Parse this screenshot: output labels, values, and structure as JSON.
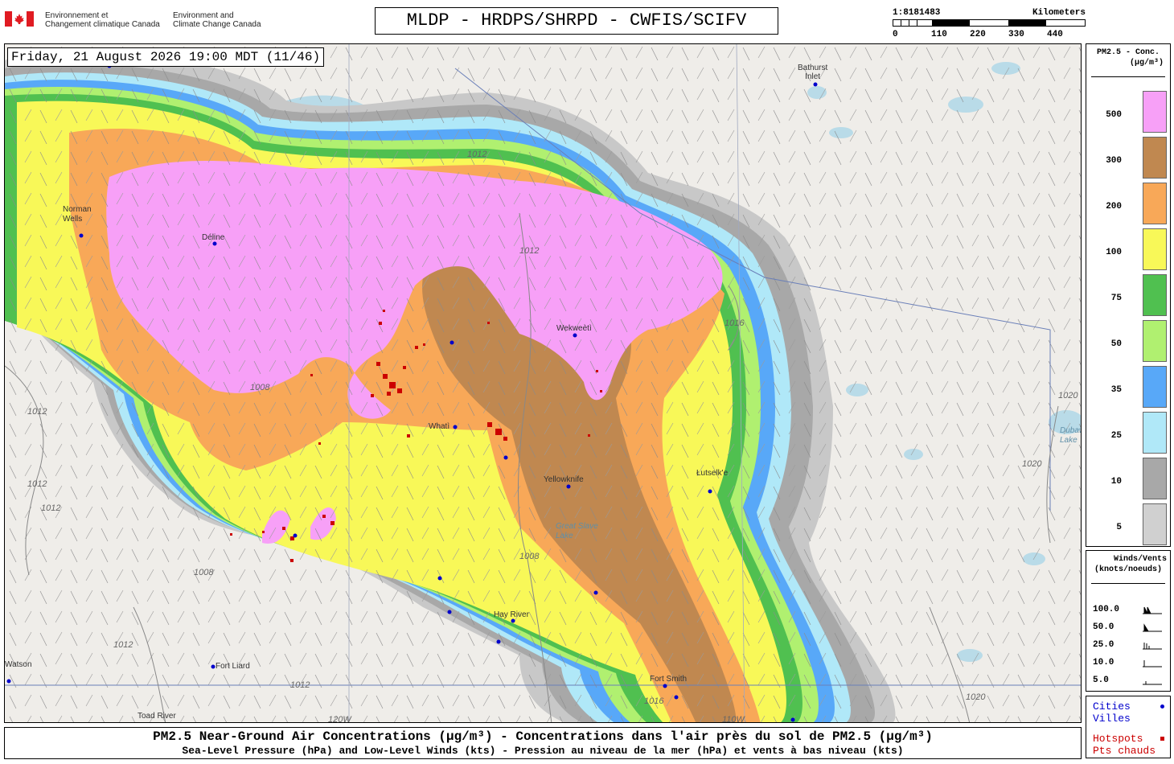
{
  "header": {
    "gov_fr_line1": "Environnement et",
    "gov_fr_line2": "Changement climatique Canada",
    "gov_en_line1": "Environment and",
    "gov_en_line2": "Climate Change Canada",
    "title": "MLDP - HRDPS/SHRPD - CWFIS/SCIFV"
  },
  "scale_bar": {
    "ratio": "1:8181483",
    "unit": "Kilometers",
    "ticks": [
      "0",
      "110",
      "220",
      "330",
      "440"
    ]
  },
  "map": {
    "datetime": "Friday, 21 August 2026 19:00 MDT (11/46)",
    "cities": [
      {
        "name": "Bathurst",
        "name2": "Inlet"
      },
      {
        "name": "Norman",
        "name2": "Wells"
      },
      {
        "name": "Déline"
      },
      {
        "name": "Wekweètì"
      },
      {
        "name": "Whatì"
      },
      {
        "name": "Yellowknife"
      },
      {
        "name": "Łutselk'e"
      },
      {
        "name": "Hay River"
      },
      {
        "name": "Fort Liard"
      },
      {
        "name": "Fort Smith"
      },
      {
        "name": "Toad River"
      },
      {
        "name": "Watson"
      },
      {
        "name": "Dubawnt",
        "name2": "Lake"
      },
      {
        "name": "Great Slave",
        "name2": "Lake"
      }
    ],
    "isobars": [
      "1012",
      "1012",
      "1012",
      "1016",
      "1008",
      "1008",
      "1008",
      "1012",
      "1020",
      "1020",
      "1012",
      "1012",
      "1020",
      "1016",
      "1012"
    ],
    "longitudes": [
      "120W",
      "110W"
    ]
  },
  "legend_pm25": {
    "title_line1": "PM2.5 - Conc.",
    "title_line2": "(µg/m³)",
    "bins": [
      {
        "label": "500",
        "color": "#f7a0f7"
      },
      {
        "label": "300",
        "color": "#c08850"
      },
      {
        "label": "200",
        "color": "#f8a858"
      },
      {
        "label": "100",
        "color": "#f8f858"
      },
      {
        "label": "75",
        "color": "#50c050"
      },
      {
        "label": "50",
        "color": "#b0f070"
      },
      {
        "label": "35",
        "color": "#58a8f8"
      },
      {
        "label": "25",
        "color": "#b0e8f8"
      },
      {
        "label": "10",
        "color": "#a8a8a8"
      },
      {
        "label": "5",
        "color": "#d0d0d0"
      }
    ]
  },
  "legend_winds": {
    "title_line1": "Winds/Vents",
    "title_line2": "(knots/noeuds)",
    "speeds": [
      "100.0",
      "50.0",
      "25.0",
      "10.0",
      "5.0"
    ]
  },
  "legend_points": {
    "cities_en": "Cities",
    "cities_fr": "Villes",
    "hotspots_en": "Hotspots",
    "hotspots_fr": "Pts chauds"
  },
  "footer": {
    "line1": "PM2.5 Near-Ground Air Concentrations (µg/m³) - Concentrations dans l'air près du sol de PM2.5 (µg/m³)",
    "line2": "Sea-Level Pressure (hPa) and Low-Level Winds (kts) - Pression au niveau de la mer (hPa) et vents à bas niveau (kts)"
  },
  "colors": {
    "city_dot": "#0000cc",
    "hotspot": "#cc0000",
    "water": "#b9dbe8"
  }
}
